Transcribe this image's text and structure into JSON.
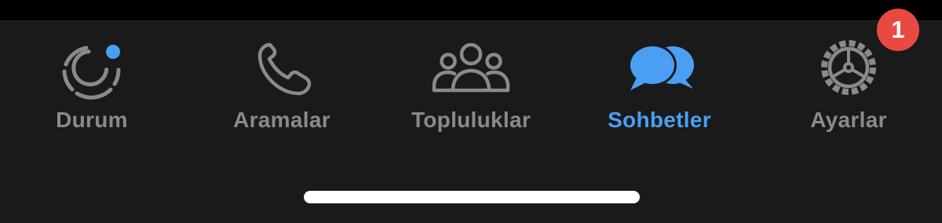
{
  "tab_bar": {
    "active_tab": "Sohbetler",
    "tabs": [
      {
        "id": "durum",
        "label": "Durum",
        "icon": "status-icon",
        "has_dot": true
      },
      {
        "id": "aramalar",
        "label": "Aramalar",
        "icon": "phone-icon"
      },
      {
        "id": "topluluklar",
        "label": "Topluluklar",
        "icon": "communities-icon"
      },
      {
        "id": "sohbetler",
        "label": "Sohbetler",
        "icon": "chat-bubbles-icon",
        "active": true
      },
      {
        "id": "ayarlar",
        "label": "Ayarlar",
        "icon": "gear-icon",
        "badge": "1"
      }
    ]
  },
  "colors": {
    "background": "#1a1a1a",
    "inactive": "#8a8a8a",
    "active": "#4a9ff5",
    "badge": "#e84a43",
    "home_indicator": "#ffffff"
  }
}
